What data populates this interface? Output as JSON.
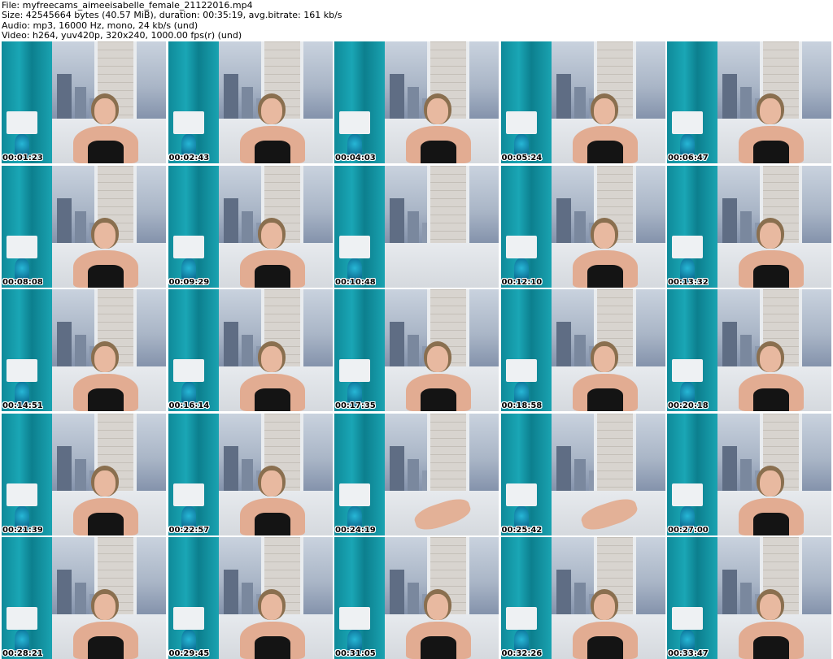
{
  "header": {
    "file_line": "File: myfreecams_aimeeisabelle_female_21122016.mp4",
    "size_line": "Size: 42545664 bytes (40.57 MiB), duration: 00:35:19, avg.bitrate: 161 kb/s",
    "audio_line": "Audio: mp3, 16000 Hz, mono, 24 kb/s (und)",
    "video_line": "Video: h264, yuv420p, 320x240, 1000.00 fps(r) (und)"
  },
  "thumbnails": [
    {
      "timestamp": "00:01:23",
      "scene": "person"
    },
    {
      "timestamp": "00:02:43",
      "scene": "person"
    },
    {
      "timestamp": "00:04:03",
      "scene": "person"
    },
    {
      "timestamp": "00:05:24",
      "scene": "person"
    },
    {
      "timestamp": "00:06:47",
      "scene": "person"
    },
    {
      "timestamp": "00:08:08",
      "scene": "person"
    },
    {
      "timestamp": "00:09:29",
      "scene": "person"
    },
    {
      "timestamp": "00:10:48",
      "scene": "empty"
    },
    {
      "timestamp": "00:12:10",
      "scene": "person"
    },
    {
      "timestamp": "00:13:32",
      "scene": "person"
    },
    {
      "timestamp": "00:14:51",
      "scene": "person"
    },
    {
      "timestamp": "00:16:14",
      "scene": "person"
    },
    {
      "timestamp": "00:17:35",
      "scene": "person"
    },
    {
      "timestamp": "00:18:58",
      "scene": "person"
    },
    {
      "timestamp": "00:20:18",
      "scene": "person"
    },
    {
      "timestamp": "00:21:39",
      "scene": "person"
    },
    {
      "timestamp": "00:22:57",
      "scene": "person"
    },
    {
      "timestamp": "00:24:19",
      "scene": "legs"
    },
    {
      "timestamp": "00:25:42",
      "scene": "legs"
    },
    {
      "timestamp": "00:27:00",
      "scene": "person"
    },
    {
      "timestamp": "00:28:21",
      "scene": "person"
    },
    {
      "timestamp": "00:29:45",
      "scene": "person"
    },
    {
      "timestamp": "00:31:05",
      "scene": "person"
    },
    {
      "timestamp": "00:32:26",
      "scene": "person"
    },
    {
      "timestamp": "00:33:47",
      "scene": "person"
    }
  ],
  "colors": {
    "curtain": "#1aa6b5",
    "background": "#ffffff",
    "text": "#000000"
  }
}
